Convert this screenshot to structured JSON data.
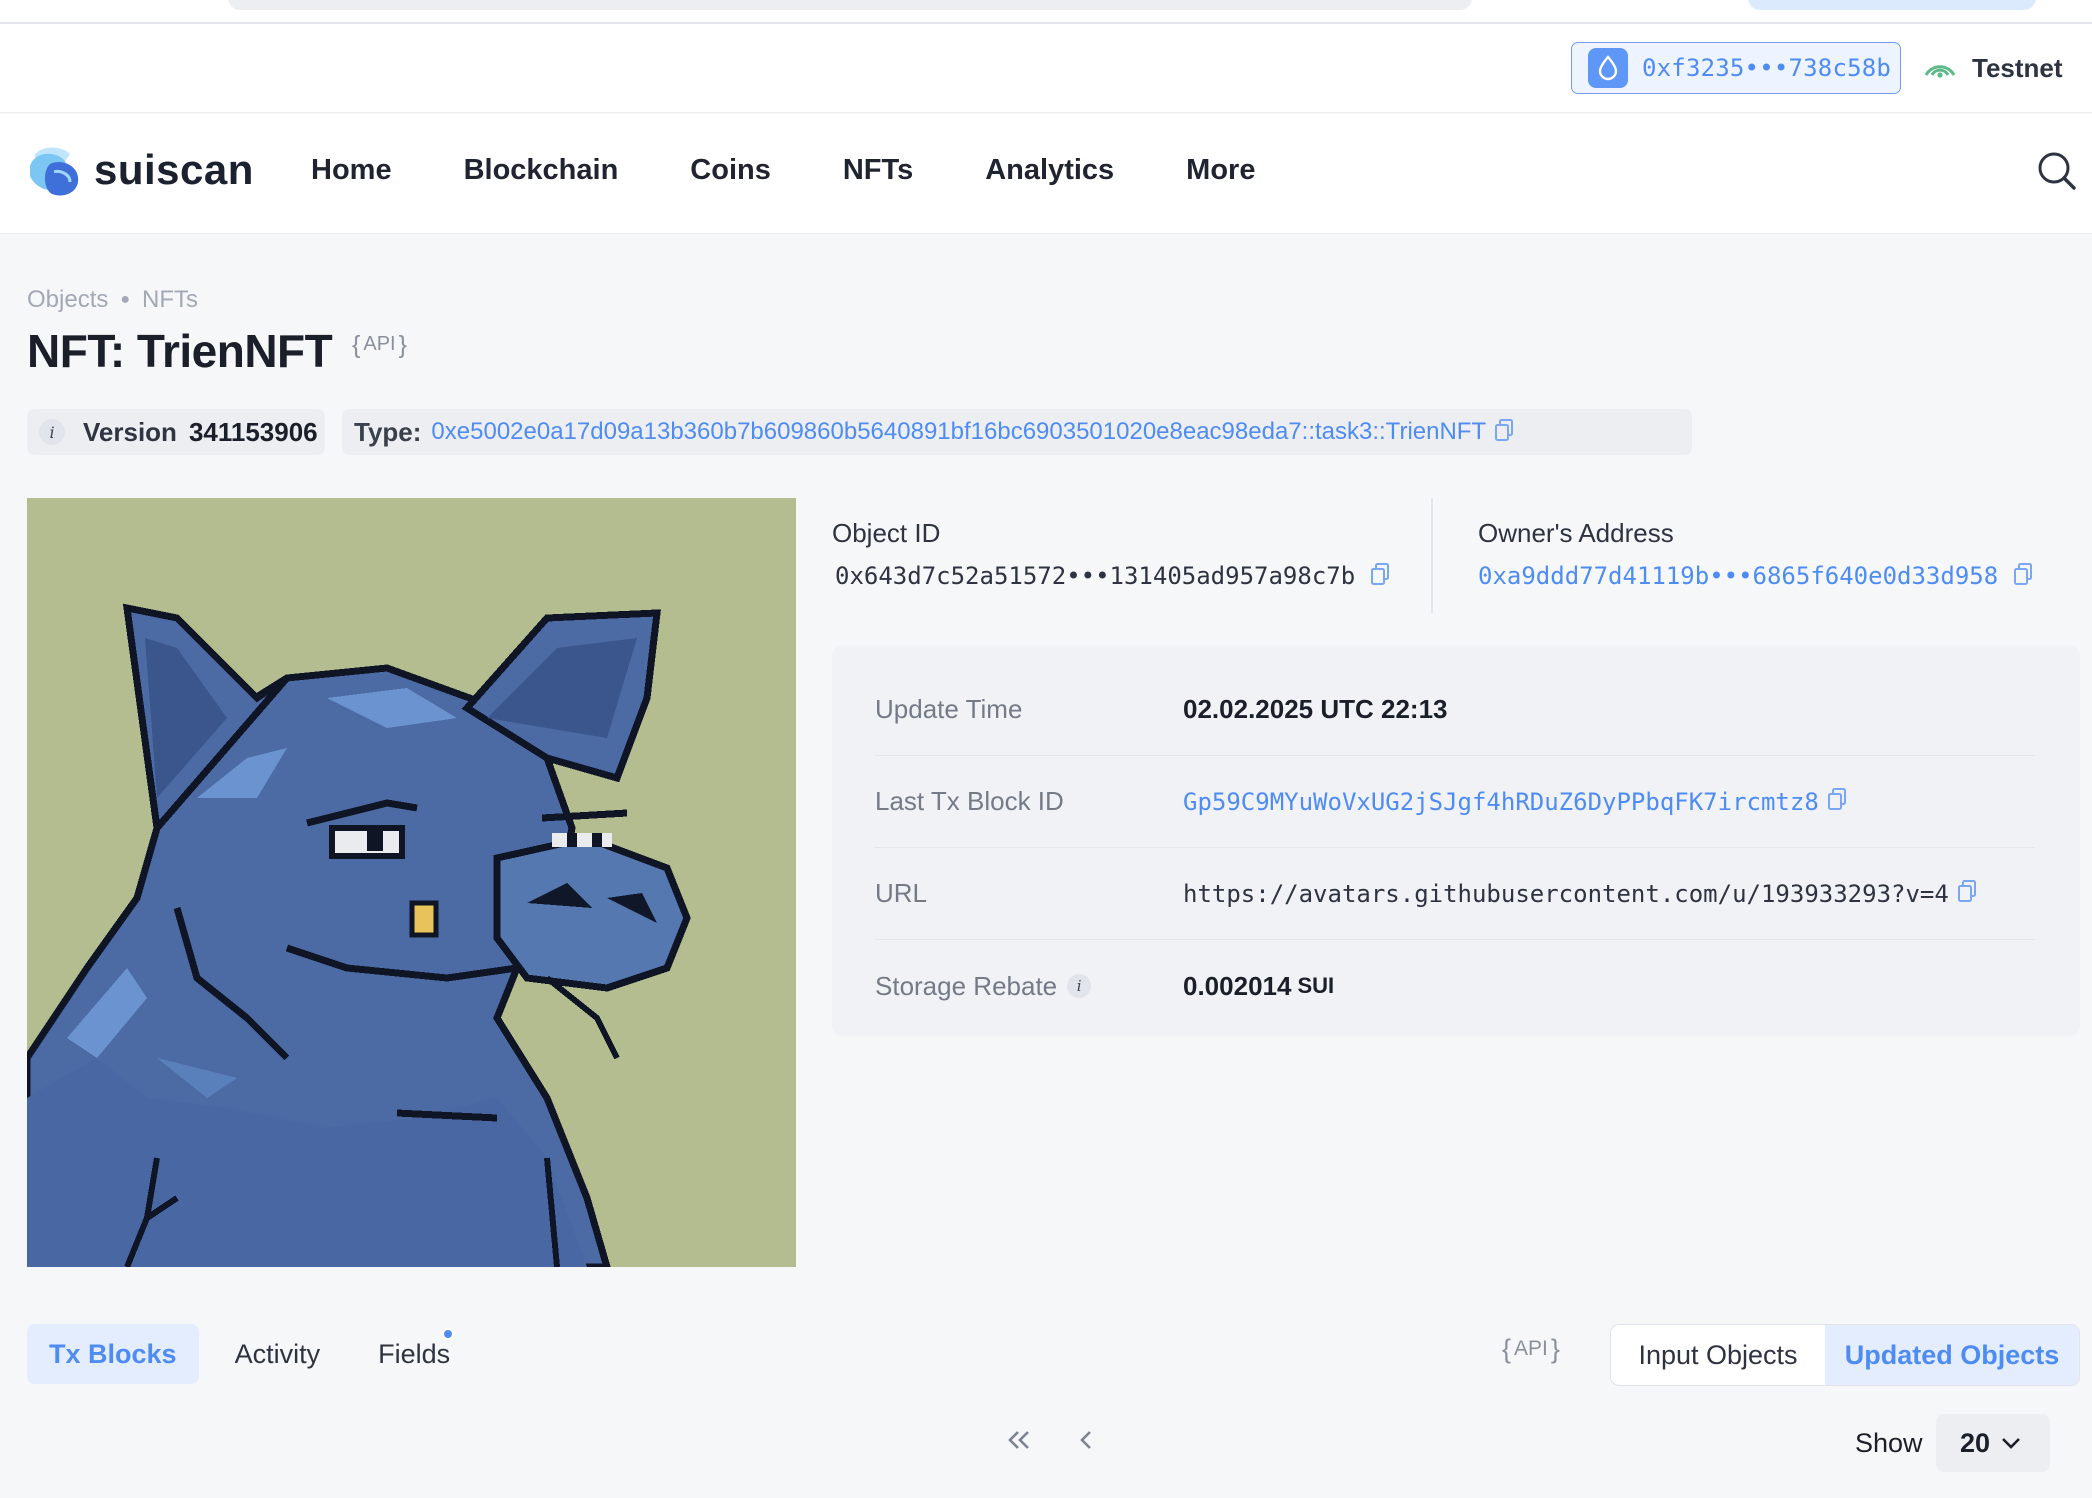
{
  "wallet": {
    "address": "0xf3235•••738c58b",
    "network": "Testnet"
  },
  "brand": {
    "name": "suiscan"
  },
  "nav": {
    "items": [
      "Home",
      "Blockchain",
      "Coins",
      "NFTs",
      "Analytics",
      "More"
    ]
  },
  "breadcrumb": [
    "Objects",
    "NFTs"
  ],
  "title": "NFT: TrienNFT",
  "api_badge": "API",
  "version": {
    "label": "Version",
    "value": "341153906"
  },
  "type": {
    "label": "Type:",
    "value": "0xe5002e0a17d09a13b360b7b609860b5640891bf16bc6903501020e8eac98eda7::task3::TrienNFT"
  },
  "object": {
    "id_label": "Object ID",
    "id_value": "0x643d7c52a51572•••131405ad957a98c7b",
    "owner_label": "Owner's Address",
    "owner_value": "0xa9ddd77d41119b•••6865f640e0d33d958"
  },
  "details": {
    "update_time_label": "Update Time",
    "update_time_value": "02.02.2025 UTC 22:13",
    "last_tx_label": "Last Tx Block ID",
    "last_tx_value": "Gp59C9MYuWoVxUG2jSJgf4hRDuZ6DyPPbqFK7ircmtz8",
    "url_label": "URL",
    "url_value": "https://avatars.githubusercontent.com/u/193933293?v=4",
    "storage_label": "Storage Rebate",
    "storage_value": "0.002014",
    "storage_unit": "SUI"
  },
  "tabs": [
    "Tx Blocks",
    "Activity",
    "Fields"
  ],
  "segment": {
    "input": "Input Objects",
    "updated": "Updated Objects"
  },
  "pagination": {
    "first": "<<",
    "prev": "<",
    "show_label": "Show",
    "show_value": "20"
  },
  "colors": {
    "accent": "#4e8cf3",
    "image_bg": "#b4bd90",
    "pig": "#4d6fa6"
  }
}
